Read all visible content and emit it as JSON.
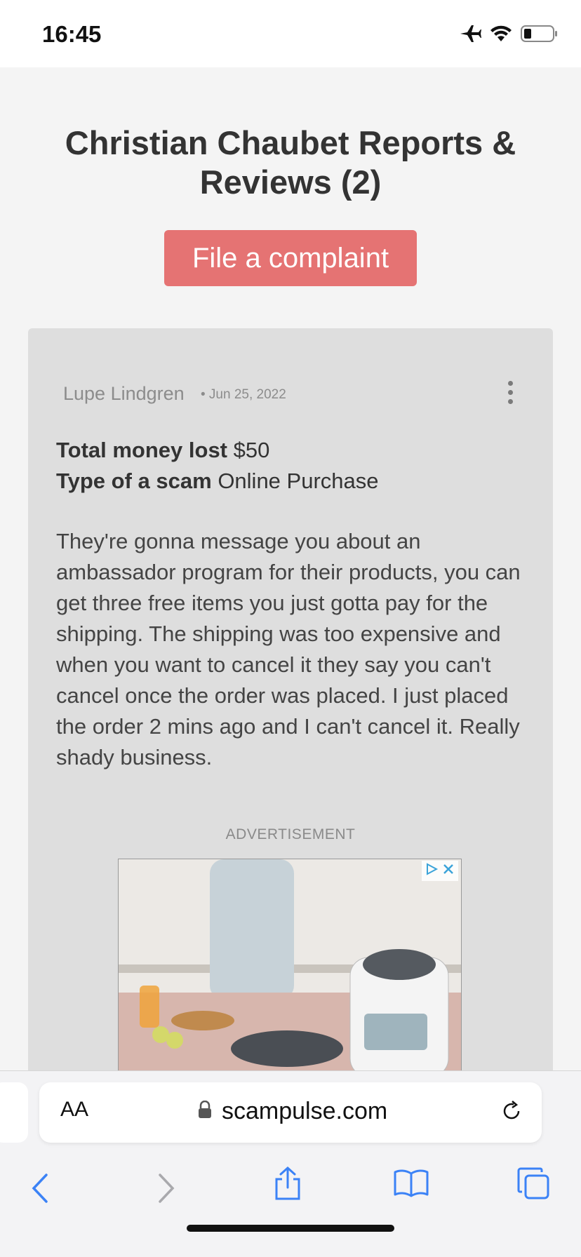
{
  "status_bar": {
    "time": "16:45",
    "icons": [
      "airplane-icon",
      "wifi-icon",
      "battery-icon"
    ]
  },
  "page": {
    "title": "Christian Chaubet Reports & Reviews (2)",
    "complaint_button": "File a complaint"
  },
  "review": {
    "author": "Lupe Lindgren",
    "date": "• Jun 25, 2022",
    "money_lost_label": "Total money lost",
    "money_lost_value": "$50",
    "scam_type_label": "Type of a scam",
    "scam_type_value": "Online Purchase",
    "body": "They're gonna message you about an ambassador program for their products, you can get three free items you just gotta pay for the shipping. The shipping was too expensive and when you want to cancel it they say you can't cancel once the order was placed. I just placed the order 2 mins ago and I can't cancel it. Really shady business."
  },
  "advertisement": {
    "label": "ADVERTISEMENT"
  },
  "browser": {
    "aa_label": "AA",
    "url": "scampulse.com",
    "toolbar_icons": [
      "back-icon",
      "forward-icon",
      "share-icon",
      "bookmarks-icon",
      "tabs-icon"
    ]
  },
  "colors": {
    "accent_button": "#e57373",
    "ios_blue": "#3b82f6",
    "card_bg": "#dedede"
  }
}
